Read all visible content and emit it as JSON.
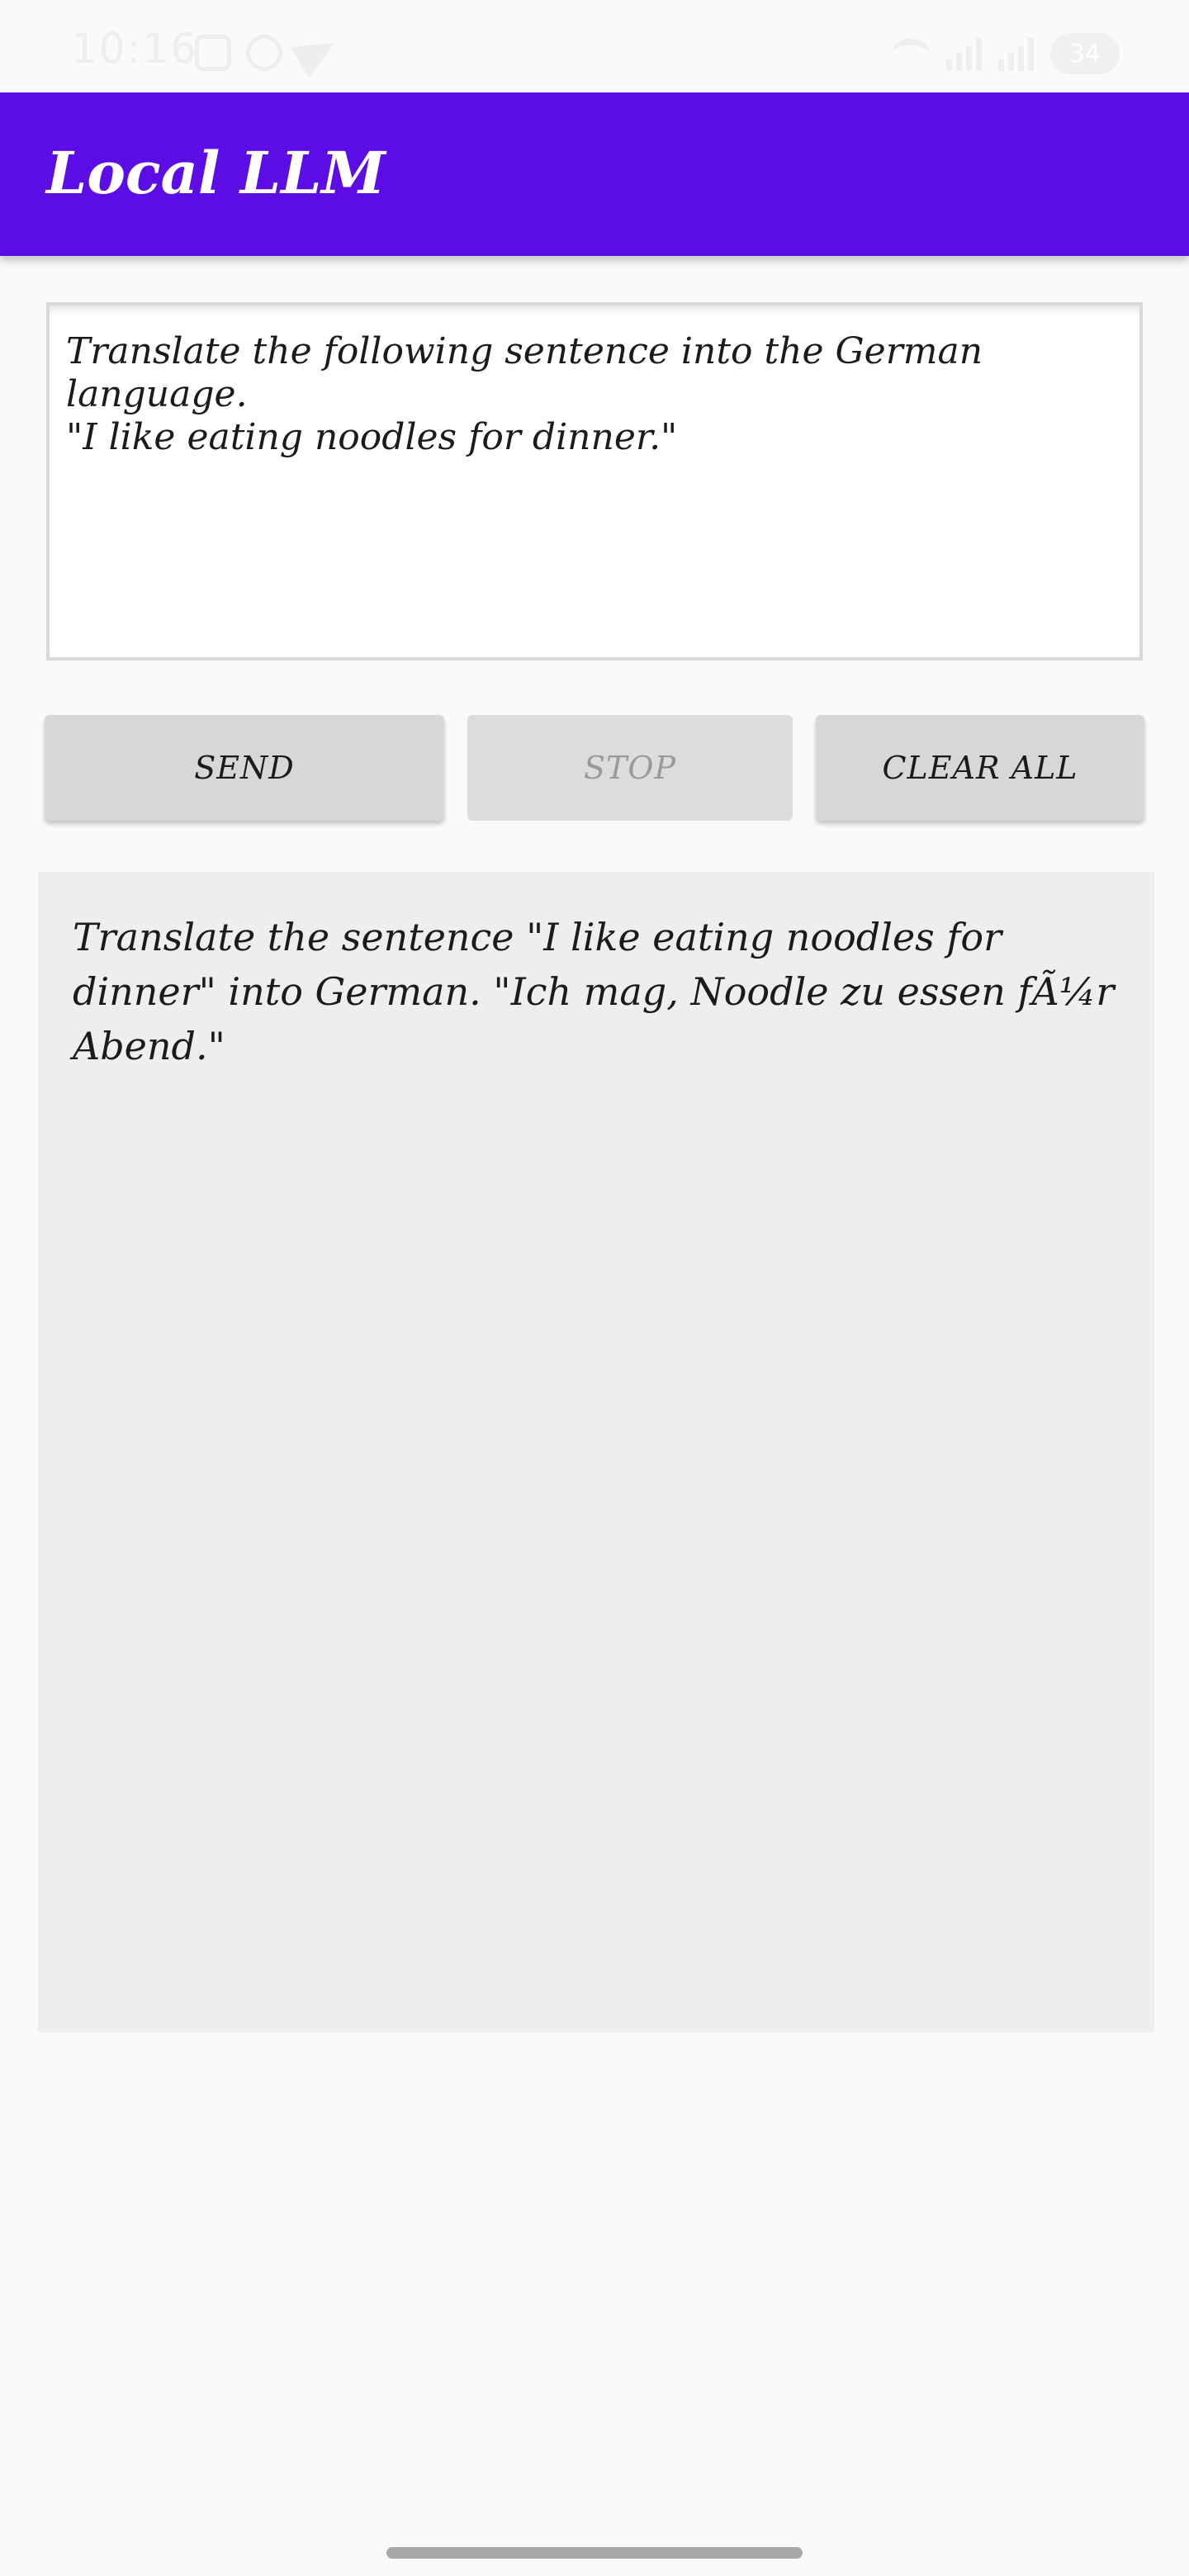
{
  "status_bar": {
    "time": "10:16",
    "battery": "34"
  },
  "app_bar": {
    "title": "Local LLM"
  },
  "prompt": {
    "value": "Translate the following sentence into the German language.\n\"I like eating noodles for dinner.\""
  },
  "buttons": {
    "send": "SEND",
    "stop": "STOP",
    "clear_all": "CLEAR ALL"
  },
  "output": {
    "text": "Translate the sentence \"I like eating noodles for dinner\" into German. \"Ich mag, Noodle zu essen fÃ¼r Abend.\""
  },
  "colors": {
    "app_bar": "#5c0de6",
    "button": "#d6d7d7",
    "output_bg": "#eeeeee",
    "page_bg": "#fafafa"
  }
}
